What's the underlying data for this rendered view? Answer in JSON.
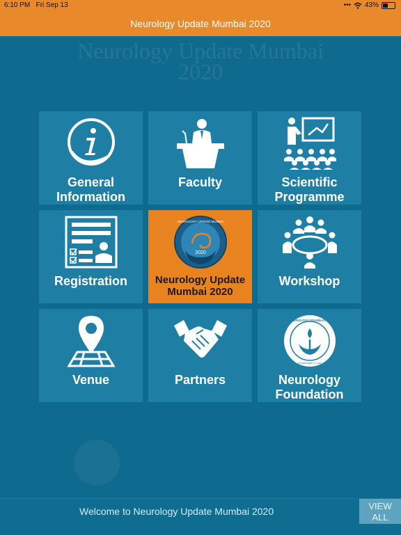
{
  "status": {
    "time": "6:10 PM",
    "date": "Fri Sep 13",
    "battery": "43%"
  },
  "header": {
    "title": "Neurology Update Mumbai 2020"
  },
  "background": {
    "title_line1": "Neurology Update Mumbai",
    "title_line2": "2020"
  },
  "tiles": [
    {
      "label": "General\nInformation",
      "icon": "info-icon"
    },
    {
      "label": "Faculty",
      "icon": "speaker-podium-icon"
    },
    {
      "label": "Scientific\nProgramme",
      "icon": "presentation-icon"
    },
    {
      "label": "Registration",
      "icon": "registration-form-icon"
    },
    {
      "label": "Neurology Update\nMumbai 2020",
      "icon": "event-logo-icon",
      "logo_text": "NEUROLOGY UPDATE MUMBAI",
      "logo_year": "2020"
    },
    {
      "label": "Workshop",
      "icon": "meeting-table-icon"
    },
    {
      "label": "Venue",
      "icon": "map-pin-icon"
    },
    {
      "label": "Partners",
      "icon": "handshake-icon"
    },
    {
      "label": "Neurology\nFoundation",
      "icon": "foundation-logo-icon",
      "logo_text": "NEUROLOGY FOUNDATION",
      "logo_sub": "Knowledge & Care"
    }
  ],
  "footer": {
    "welcome": "Welcome to Neurology Update Mumbai 2020",
    "view_all": "VIEW\nALL"
  },
  "colors": {
    "accent": "#e88a2c",
    "background": "#0e6a8f",
    "tile": "#1e7ea3",
    "center_tile": "#e8831f"
  }
}
